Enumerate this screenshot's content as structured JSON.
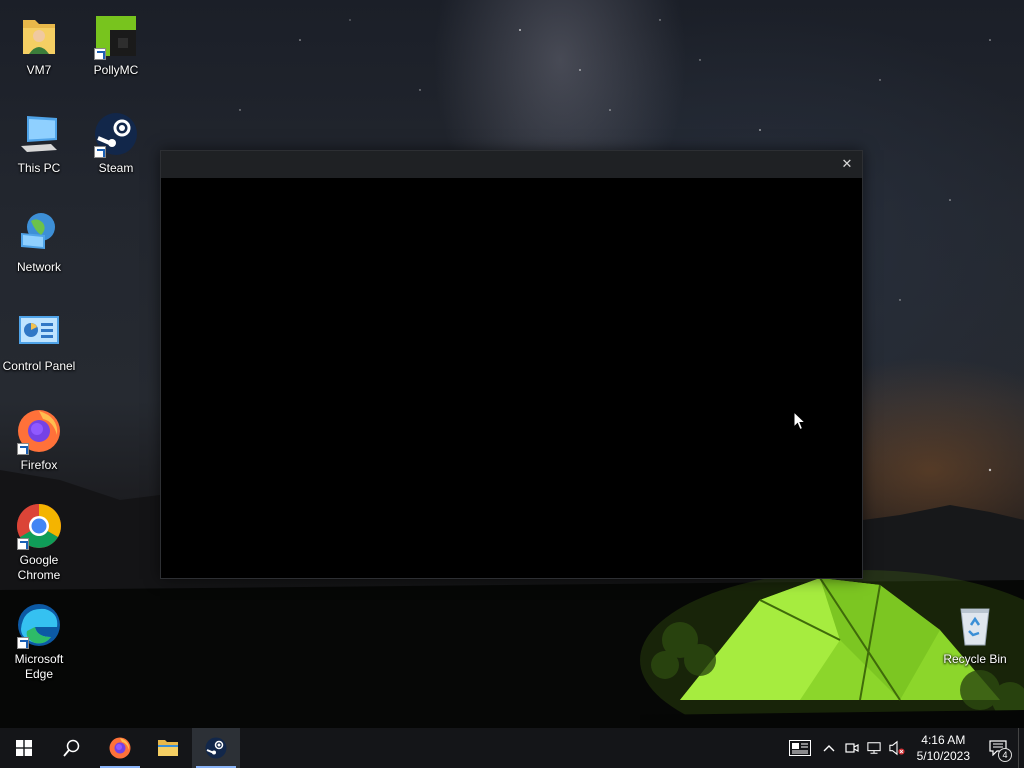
{
  "desktop": {
    "icons": [
      {
        "label": "VM7",
        "icon": "user-folder-icon"
      },
      {
        "label": "PollyMC",
        "icon": "pollymc-icon"
      },
      {
        "label": "This PC",
        "icon": "computer-icon"
      },
      {
        "label": "Steam",
        "icon": "steam-icon"
      },
      {
        "label": "Network",
        "icon": "network-icon"
      },
      {
        "label": "Control Panel",
        "icon": "control-panel-icon"
      },
      {
        "label": "Firefox",
        "icon": "firefox-icon"
      },
      {
        "label": "Google Chrome",
        "icon": "chrome-icon"
      },
      {
        "label": "Microsoft Edge",
        "icon": "edge-icon"
      },
      {
        "label": "Recycle Bin",
        "icon": "recycle-bin-icon"
      }
    ]
  },
  "window": {
    "close_glyph": "✕"
  },
  "taskbar": {
    "start": "start-icon",
    "search": "search-icon",
    "apps": [
      {
        "name": "Firefox",
        "icon": "firefox-icon",
        "running": true
      },
      {
        "name": "File Explorer",
        "icon": "folder-icon",
        "running": false
      },
      {
        "name": "Steam",
        "icon": "steam-icon",
        "running": true,
        "active": true
      }
    ]
  },
  "tray": {
    "time": "4:16 AM",
    "date": "5/10/2023",
    "notification_count": "4"
  },
  "colors": {
    "taskbar": "#141518",
    "accent": "#8ab4f8"
  }
}
